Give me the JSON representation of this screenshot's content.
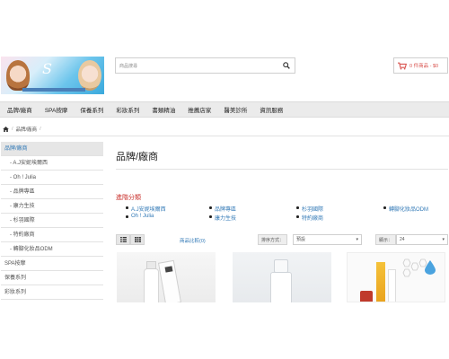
{
  "search": {
    "placeholder": "商品搜尋"
  },
  "cart": {
    "label": "0 件商品 - $0"
  },
  "nav": {
    "items": [
      "品牌/廠商",
      "SPA按摩",
      "保養系列",
      "彩妝系列",
      "書類精油",
      "推薦店家",
      "醫美診所",
      "資訊服務"
    ]
  },
  "breadcrumb": {
    "current": "品牌/廠商"
  },
  "sidebar": {
    "items": [
      {
        "label": "品牌/廠商",
        "active": true,
        "sub": false
      },
      {
        "label": "- A.J安妮埃爾西",
        "active": false,
        "sub": true
      },
      {
        "label": "- Oh ! Julia",
        "active": false,
        "sub": true
      },
      {
        "label": "- 品牌專區",
        "active": false,
        "sub": true
      },
      {
        "label": "- 康力生技",
        "active": false,
        "sub": true
      },
      {
        "label": "- 杉羽國際",
        "active": false,
        "sub": true
      },
      {
        "label": "- 特約廠商",
        "active": false,
        "sub": true
      },
      {
        "label": "- 轉腳化妝品ODM",
        "active": false,
        "sub": true
      },
      {
        "label": "SPA按摩",
        "active": false,
        "sub": false
      },
      {
        "label": "保養系列",
        "active": false,
        "sub": false
      },
      {
        "label": "彩妝系列",
        "active": false,
        "sub": false
      }
    ]
  },
  "main": {
    "title": "品牌/廠商",
    "advanced_label": "進階分類",
    "categories": [
      [
        "A.J安妮埃爾西",
        "Oh ! Julia"
      ],
      [
        "品牌專區",
        "康力生技"
      ],
      [
        "杉羽國際",
        "特約廠商"
      ],
      [
        "轉腳化妝品ODM"
      ]
    ],
    "compare_label": "商品比較(0)",
    "sort_label": "排序方式：",
    "sort_value": "預設",
    "limit_label": "顯示：",
    "limit_value": "24"
  },
  "colors": {
    "accent": "#337ab7",
    "alert": "#c9302c",
    "nav_bg": "#ebebeb"
  }
}
